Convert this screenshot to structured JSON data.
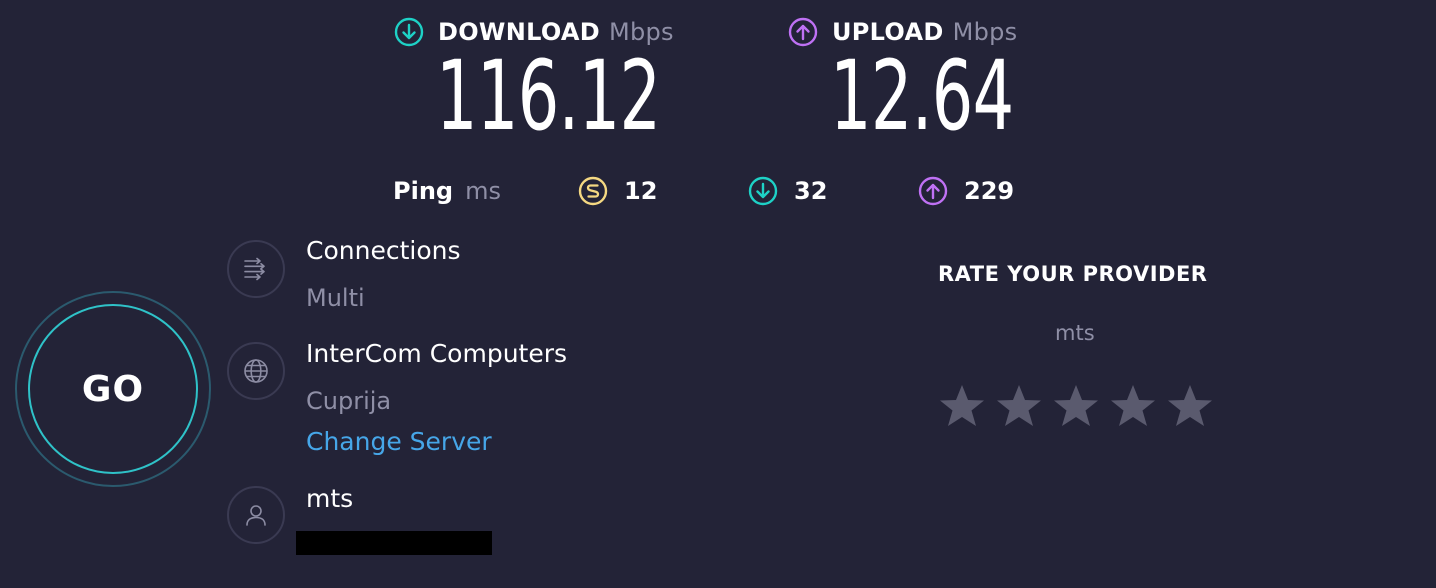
{
  "download": {
    "label": "DOWNLOAD",
    "unit": "Mbps",
    "value": "116.12",
    "color": "#1ed1c6",
    "icon": "arrow-down-circle-icon"
  },
  "upload": {
    "label": "UPLOAD",
    "unit": "Mbps",
    "value": "12.64",
    "color": "#bf71f4",
    "icon": "arrow-up-circle-icon"
  },
  "ping": {
    "label": "Ping",
    "unit": "ms",
    "idle": {
      "value": "12",
      "color": "#f4d882",
      "icon": "jitter-icon"
    },
    "download": {
      "value": "32",
      "color": "#1ed1c6",
      "icon": "arrow-down-circle-icon"
    },
    "upload": {
      "value": "229",
      "color": "#bf71f4",
      "icon": "arrow-up-circle-icon"
    }
  },
  "go_button": {
    "label": "GO"
  },
  "connections": {
    "title": "Connections",
    "value": "Multi",
    "icon": "connections-icon"
  },
  "server": {
    "title": "InterCom Computers",
    "location": "Cuprija",
    "change_label": "Change Server",
    "icon": "globe-icon"
  },
  "isp": {
    "name": "mts",
    "icon": "user-icon"
  },
  "rating": {
    "title": "RATE YOUR PROVIDER",
    "provider": "mts",
    "max_stars": 5,
    "current_rating": 0,
    "star_color": "#5a5a6e"
  }
}
